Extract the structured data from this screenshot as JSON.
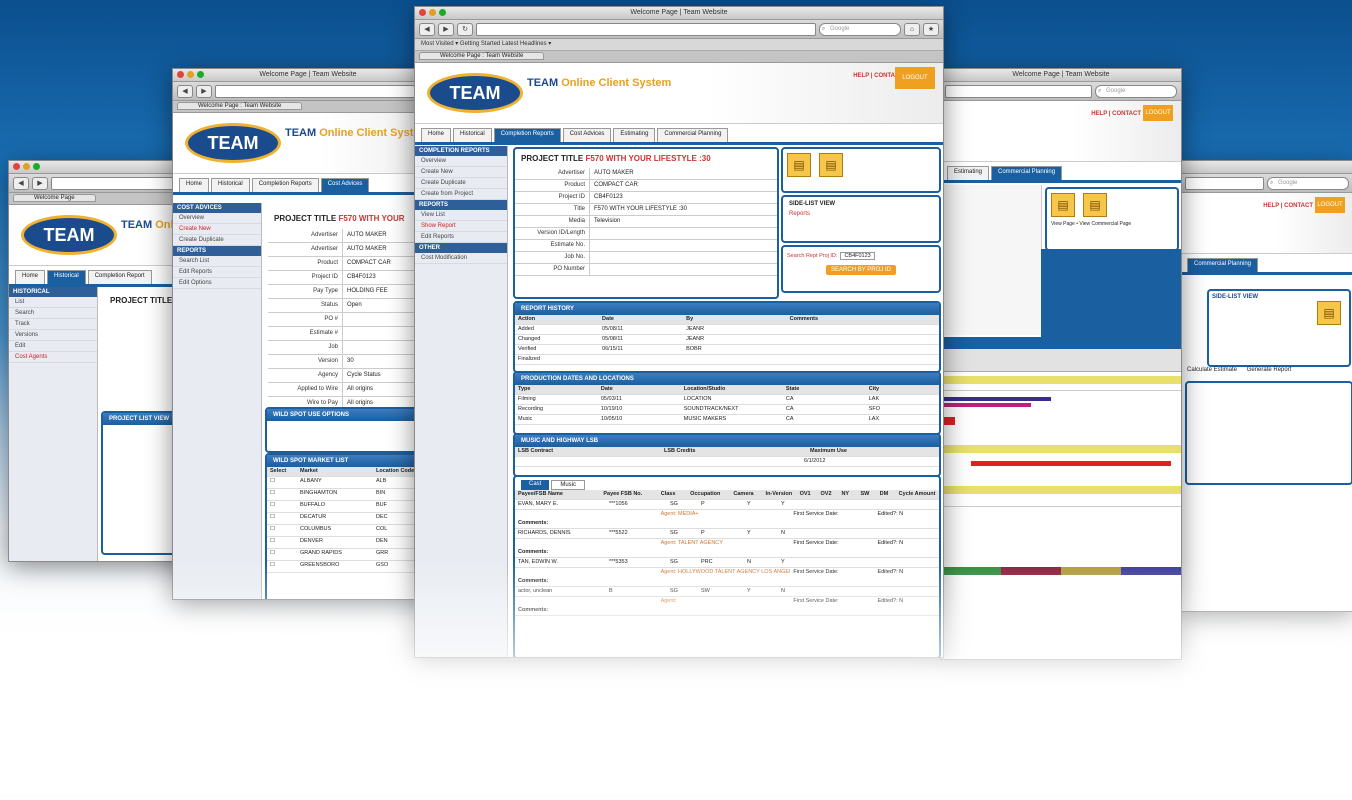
{
  "main_window": {
    "title": "Welcome Page | Team Website",
    "search_placeholder": "Google",
    "bookmarks": "Most Visited ▾   Getting Started   Latest Headlines ▾",
    "tab": "Welcome Page : Team Website",
    "logo": "TEAM",
    "brand_name": "TEAM",
    "brand_tag": "Online Client System",
    "help": "HELP",
    "contact": "CONTACT",
    "logout": "LOGOUT",
    "nav_tabs": [
      "Home",
      "Historical",
      "Completion Reports",
      "Cost Advices",
      "Estimating",
      "Commercial Planning"
    ],
    "sidebar_sections": [
      {
        "head": "COMPLETION REPORTS",
        "items": [
          "Overview",
          "Create New",
          "Create Duplicate",
          "Create from Project"
        ]
      },
      {
        "head": "REPORTS",
        "items": [
          "View List",
          "Show Report",
          "Edit Reports"
        ]
      },
      {
        "head": "OTHER",
        "items": [
          "Cost Modification"
        ]
      }
    ],
    "project_title_label": "PROJECT TITLE",
    "project_title_value": "F570 WITH YOUR LIFESTYLE :30",
    "fields": [
      {
        "k": "Advertiser",
        "v": "AUTO MAKER"
      },
      {
        "k": "Product",
        "v": "COMPACT CAR"
      },
      {
        "k": "Project ID",
        "v": "CB4F0123"
      },
      {
        "k": "Title",
        "v": "F570 WITH YOUR LIFESTYLE :30"
      },
      {
        "k": "Media",
        "v": "Television"
      },
      {
        "k": "Version ID/Length",
        "v": ""
      },
      {
        "k": "Estimate No.",
        "v": ""
      },
      {
        "k": "Job No.",
        "v": ""
      },
      {
        "k": "PO Number",
        "v": ""
      }
    ],
    "side_list_title": "SIDE-LIST VIEW",
    "side_list_link": "Reports",
    "search_label": "Search Rept Proj ID:",
    "search_value": "CB4F0123",
    "search_button": "SEARCH BY PROJ ID",
    "report_history": {
      "title": "REPORT HISTORY",
      "columns": [
        "Action",
        "Date",
        "By",
        "Comments"
      ],
      "rows": [
        [
          "Added",
          "05/08/11",
          "JEANR",
          ""
        ],
        [
          "Changed",
          "05/08/11",
          "JEANR",
          ""
        ],
        [
          "Verified",
          "06/15/11",
          "BOBR",
          ""
        ],
        [
          "Finalized",
          "",
          "",
          ""
        ]
      ]
    },
    "production": {
      "title": "PRODUCTION DATES AND LOCATIONS",
      "columns": [
        "Type",
        "Date",
        "Location/Studio",
        "State",
        "City"
      ],
      "rows": [
        [
          "Filming",
          "05/03/11",
          "LOCATION",
          "CA",
          "LAK"
        ],
        [
          "Recording",
          "10/19/10",
          "SOUNDTRACK/NEXT",
          "CA",
          "SFO"
        ],
        [
          "Music",
          "10/05/10",
          "MUSIC MAKERS",
          "CA",
          "LAX"
        ]
      ]
    },
    "music": {
      "title": "MUSIC AND HIGHWAY LSB",
      "columns": [
        "LSB Contract",
        "LSB Credits",
        "Maximum Use"
      ],
      "value": "6/1/2012"
    },
    "talent": {
      "tabs": [
        "Cast",
        "Music"
      ],
      "columns": [
        "Payee/FSB Name",
        "Payee FSB No.",
        "Class",
        "Occupation",
        "Camera",
        "In-Version",
        "OV1",
        "OV2",
        "NY",
        "SW",
        "DM",
        "Cycle Amount"
      ],
      "entries": [
        {
          "name": "EVAN, MARY E.",
          "no": "***1056",
          "cls": "SG",
          "occ": "P",
          "cam": "Y",
          "inv": "Y",
          "agent": "Agent: MEDIA+",
          "first": "First Service Date:",
          "edited": "Edited?: N"
        },
        {
          "name": "RICHARDS, DENNIS",
          "no": "***5522",
          "cls": "SG",
          "occ": "P",
          "cam": "Y",
          "inv": "N",
          "agent": "Agent: TALENT AGENCY",
          "first": "First Service Date:",
          "edited": "Edited?: N"
        },
        {
          "name": "TAN, EDWIN W.",
          "no": "***5353",
          "cls": "SG",
          "occ": "PRC",
          "cam": "N",
          "inv": "Y",
          "agent": "Agent: HOLLYWOOD TALENT AGENCY LOS ANGELES",
          "first": "First Service Date:",
          "edited": "Edited?: N"
        },
        {
          "name": "actor, unclean",
          "no": "B",
          "cls": "SG",
          "occ": "SW",
          "cam": "Y",
          "inv": "N",
          "agent": "Agent:",
          "first": "First Service Date:",
          "edited": "Edited?: N"
        }
      ],
      "comments_label": "Comments:"
    }
  },
  "left_window": {
    "title": "Welcome Page | Team Website",
    "tab": "Welcome Page : Team Website",
    "logo": "TEAM",
    "brand_name": "TEAM",
    "brand_tag": "Online Client System",
    "nav_tabs": [
      "Home",
      "Historical",
      "Completion Reports",
      "Cost Advices"
    ],
    "sidebar_items": [
      "Overview",
      "Create New",
      "Create Duplicate",
      "Search List",
      "Edit Reports",
      "Edit Options"
    ],
    "project_title_label": "PROJECT TITLE",
    "project_title_value": "F570 WITH YOUR",
    "fields": [
      {
        "k": "Advertiser",
        "v": "AUTO MAKER"
      },
      {
        "k": "Advertiser",
        "v": "AUTO MAKER"
      },
      {
        "k": "Product",
        "v": "COMPACT CAR"
      },
      {
        "k": "Project ID",
        "v": "CB4F0123"
      },
      {
        "k": "Pay Type",
        "v": "HOLDING FEE"
      },
      {
        "k": "Status",
        "v": "Open"
      },
      {
        "k": "PO #",
        "v": ""
      },
      {
        "k": "Estimate #",
        "v": ""
      },
      {
        "k": "Job",
        "v": ""
      },
      {
        "k": "Version",
        "v": "30"
      },
      {
        "k": "Agency",
        "v": "Cycle Status"
      },
      {
        "k": "Applied to Wire",
        "v": "All origins"
      },
      {
        "k": "Wire to Pay",
        "v": "All origins"
      }
    ],
    "wild_spot_title": "WILD SPOT USE OPTIONS",
    "wild_spot_list": "WILD SPOT MARKET LIST",
    "market_columns": [
      "Select",
      "Market",
      "Location Code"
    ],
    "markets": [
      [
        "ALBANY",
        "ALB"
      ],
      [
        "BINGHAMTON",
        "BIN"
      ],
      [
        "BUFFALO",
        "BUF"
      ],
      [
        "DECATUR",
        "DEC"
      ],
      [
        "COLUMBUS",
        "COL"
      ],
      [
        "DENVER",
        "DEN"
      ],
      [
        "GRAND RAPIDS",
        "GRR"
      ],
      [
        "GREENSBORO",
        "GSO"
      ]
    ]
  },
  "far_left_window": {
    "logo": "TEAM",
    "brand_name": "TEAM",
    "brand_tag": "Onl",
    "nav_tabs": [
      "Home",
      "Historical",
      "Completion Report"
    ],
    "sidebar_items": [
      "List",
      "Search",
      "Track",
      "Versions",
      "Edit",
      "Cost Agents"
    ],
    "project_title_label": "PROJECT TITLE",
    "project_list_title": "PROJECT LIST VIEW"
  },
  "right_window": {
    "title": "Welcome Page | Team Website",
    "search_placeholder": "Google",
    "nav_tabs": [
      "Estimating",
      "Commercial Planning"
    ],
    "help": "HELP",
    "contact": "CONTACT",
    "logout": "LOGOUT",
    "side_note": "View Page • View Commercial Page"
  },
  "far_right_window": {
    "search_placeholder": "Google",
    "help": "HELP",
    "contact": "CONTACT",
    "nav_tab": "Commercial Planning",
    "side_list_title": "SIDE-LIST VIEW",
    "calc_estimate": "Calculate Estimate",
    "generate_report": "Generate Report"
  }
}
